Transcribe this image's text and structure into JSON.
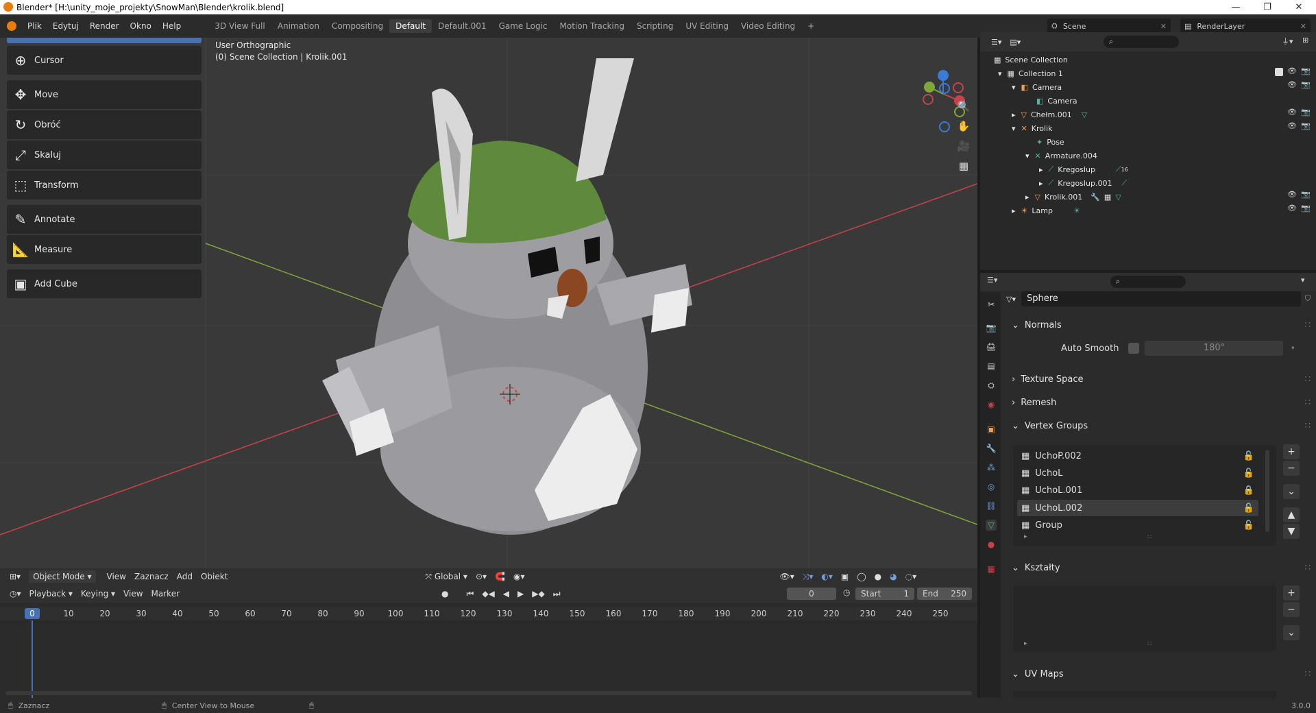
{
  "window": {
    "title": "Blender* [H:\\unity_moje_projekty\\SnowMan\\Blender\\krolik.blend]"
  },
  "menu": [
    "Plik",
    "Edytuj",
    "Render",
    "Okno",
    "Help"
  ],
  "workspaces": [
    "3D View Full",
    "Animation",
    "Compositing",
    "Default",
    "Default.001",
    "Game Logic",
    "Motion Tracking",
    "Scripting",
    "UV Editing",
    "Video Editing"
  ],
  "active_workspace": "Default",
  "scene": {
    "name": "Scene",
    "render_layer": "RenderLayer"
  },
  "tools": [
    "Cursor",
    "Move",
    "Obróć",
    "Skaluj",
    "Transform",
    "Annotate",
    "Measure",
    "Add Cube"
  ],
  "viewport": {
    "view_name": "User Orthographic",
    "collection_info": "(0) Scene Collection | Krolik.001"
  },
  "vp_header": {
    "mode": "Object Mode",
    "menus": [
      "View",
      "Zaznacz",
      "Add",
      "Obiekt"
    ],
    "transform": "Global"
  },
  "timeline": {
    "menus": [
      "Playback",
      "Keying",
      "View",
      "Marker"
    ],
    "current_frame": "0",
    "start_label": "Start",
    "start": "1",
    "end_label": "End",
    "end": "250",
    "ruler": [
      "0",
      "10",
      "20",
      "30",
      "40",
      "50",
      "60",
      "70",
      "80",
      "90",
      "100",
      "110",
      "120",
      "130",
      "140",
      "150",
      "160",
      "170",
      "180",
      "190",
      "200",
      "210",
      "220",
      "230",
      "240",
      "250"
    ]
  },
  "statusbar": {
    "left": "Zaznacz",
    "center": "Center View to Mouse",
    "version": "3.0.0"
  },
  "outliner": {
    "root": "Scene Collection",
    "rows": [
      "Collection 1",
      "Camera",
      "Camera",
      "Chełm.001",
      "Krolik",
      "Pose",
      "Armature.004",
      "Kregoslup",
      "Kregoslup.001",
      "Krolik.001",
      "Lamp"
    ],
    "badge_16": "16"
  },
  "properties": {
    "data_name": "Sphere",
    "normals": {
      "title": "Normals",
      "auto_smooth": "Auto Smooth",
      "angle": "180°"
    },
    "texture_space": "Texture Space",
    "remesh": "Remesh",
    "vertex_groups": {
      "title": "Vertex Groups",
      "items": [
        "UchoP.002",
        "UchoL",
        "UchoL.001",
        "UchoL.002",
        "Group"
      ],
      "active_index": 3
    },
    "shape_keys": "Kształty",
    "uv_maps": "UV Maps"
  },
  "colors": {
    "accent": "#4772b3",
    "x_axis": "#c9424a",
    "y_axis": "#7fa83a",
    "z_axis": "#3a7cd6"
  }
}
